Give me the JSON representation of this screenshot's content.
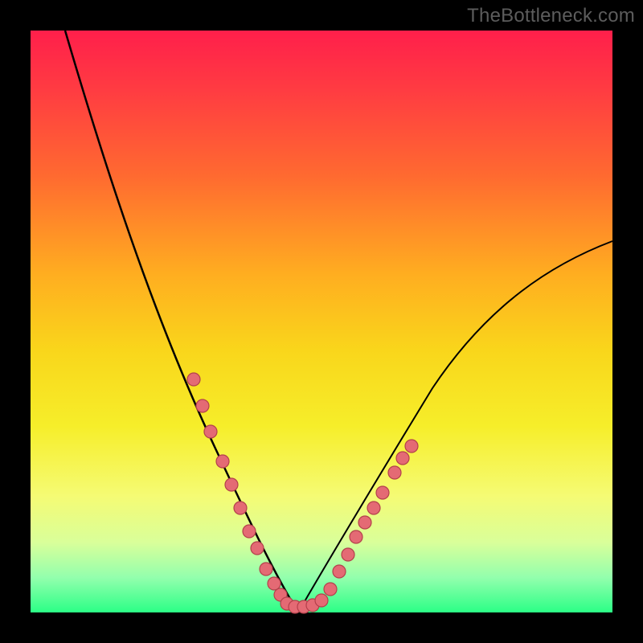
{
  "watermark": "TheBottleneck.com",
  "colors": {
    "frame": "#000000",
    "curve": "#000000",
    "dot_fill": "#e46a74",
    "dot_stroke": "#b3404b",
    "gradient_top": "#ff1f4b",
    "gradient_bottom": "#2bff86"
  },
  "chart_data": {
    "type": "line",
    "title": "",
    "xlabel": "",
    "ylabel": "",
    "xlim": [
      0,
      100
    ],
    "ylim": [
      0,
      100
    ],
    "legend": false,
    "grid": false,
    "description": "Two black curves forming a V shape meeting near x≈45, y≈0 over a rainbow background. Pink beads cluster along the curve near the bottom of the V.",
    "series": [
      {
        "name": "left-curve",
        "x": [
          6,
          10,
          15,
          20,
          25,
          28,
          30,
          33,
          35,
          38,
          40,
          42,
          44,
          46
        ],
        "y": [
          100,
          90,
          77,
          63,
          49,
          40,
          34,
          26,
          21,
          13,
          8,
          4,
          1.5,
          0
        ]
      },
      {
        "name": "right-curve",
        "x": [
          46,
          48,
          50,
          53,
          56,
          60,
          65,
          70,
          75,
          80,
          85,
          90,
          95,
          100
        ],
        "y": [
          0,
          1,
          3,
          7,
          12,
          19,
          27,
          34,
          40,
          46,
          51,
          56,
          60,
          64
        ]
      }
    ],
    "beads": [
      {
        "series": "left",
        "x": 28.0,
        "y": 40.0
      },
      {
        "series": "left",
        "x": 29.5,
        "y": 35.5
      },
      {
        "series": "left",
        "x": 31.0,
        "y": 31.0
      },
      {
        "series": "left",
        "x": 33.0,
        "y": 26.0
      },
      {
        "series": "left",
        "x": 34.5,
        "y": 22.0
      },
      {
        "series": "left",
        "x": 36.0,
        "y": 18.0
      },
      {
        "series": "left",
        "x": 37.5,
        "y": 14.0
      },
      {
        "series": "left",
        "x": 39.0,
        "y": 11.0
      },
      {
        "series": "left",
        "x": 40.5,
        "y": 7.5
      },
      {
        "series": "left",
        "x": 41.8,
        "y": 5.0
      },
      {
        "series": "left",
        "x": 43.0,
        "y": 3.0
      },
      {
        "series": "flat",
        "x": 44.0,
        "y": 1.5
      },
      {
        "series": "flat",
        "x": 45.5,
        "y": 1.0
      },
      {
        "series": "flat",
        "x": 47.0,
        "y": 1.0
      },
      {
        "series": "flat",
        "x": 48.5,
        "y": 1.3
      },
      {
        "series": "flat",
        "x": 50.0,
        "y": 2.0
      },
      {
        "series": "right",
        "x": 51.5,
        "y": 4.0
      },
      {
        "series": "right",
        "x": 53.0,
        "y": 7.0
      },
      {
        "series": "right",
        "x": 54.5,
        "y": 10.0
      },
      {
        "series": "right",
        "x": 56.0,
        "y": 13.0
      },
      {
        "series": "right",
        "x": 57.5,
        "y": 15.5
      },
      {
        "series": "right",
        "x": 59.0,
        "y": 18.0
      },
      {
        "series": "right",
        "x": 60.5,
        "y": 20.5
      },
      {
        "series": "right",
        "x": 62.5,
        "y": 24.0
      },
      {
        "series": "right",
        "x": 64.0,
        "y": 26.5
      },
      {
        "series": "right",
        "x": 65.5,
        "y": 28.5
      }
    ]
  }
}
